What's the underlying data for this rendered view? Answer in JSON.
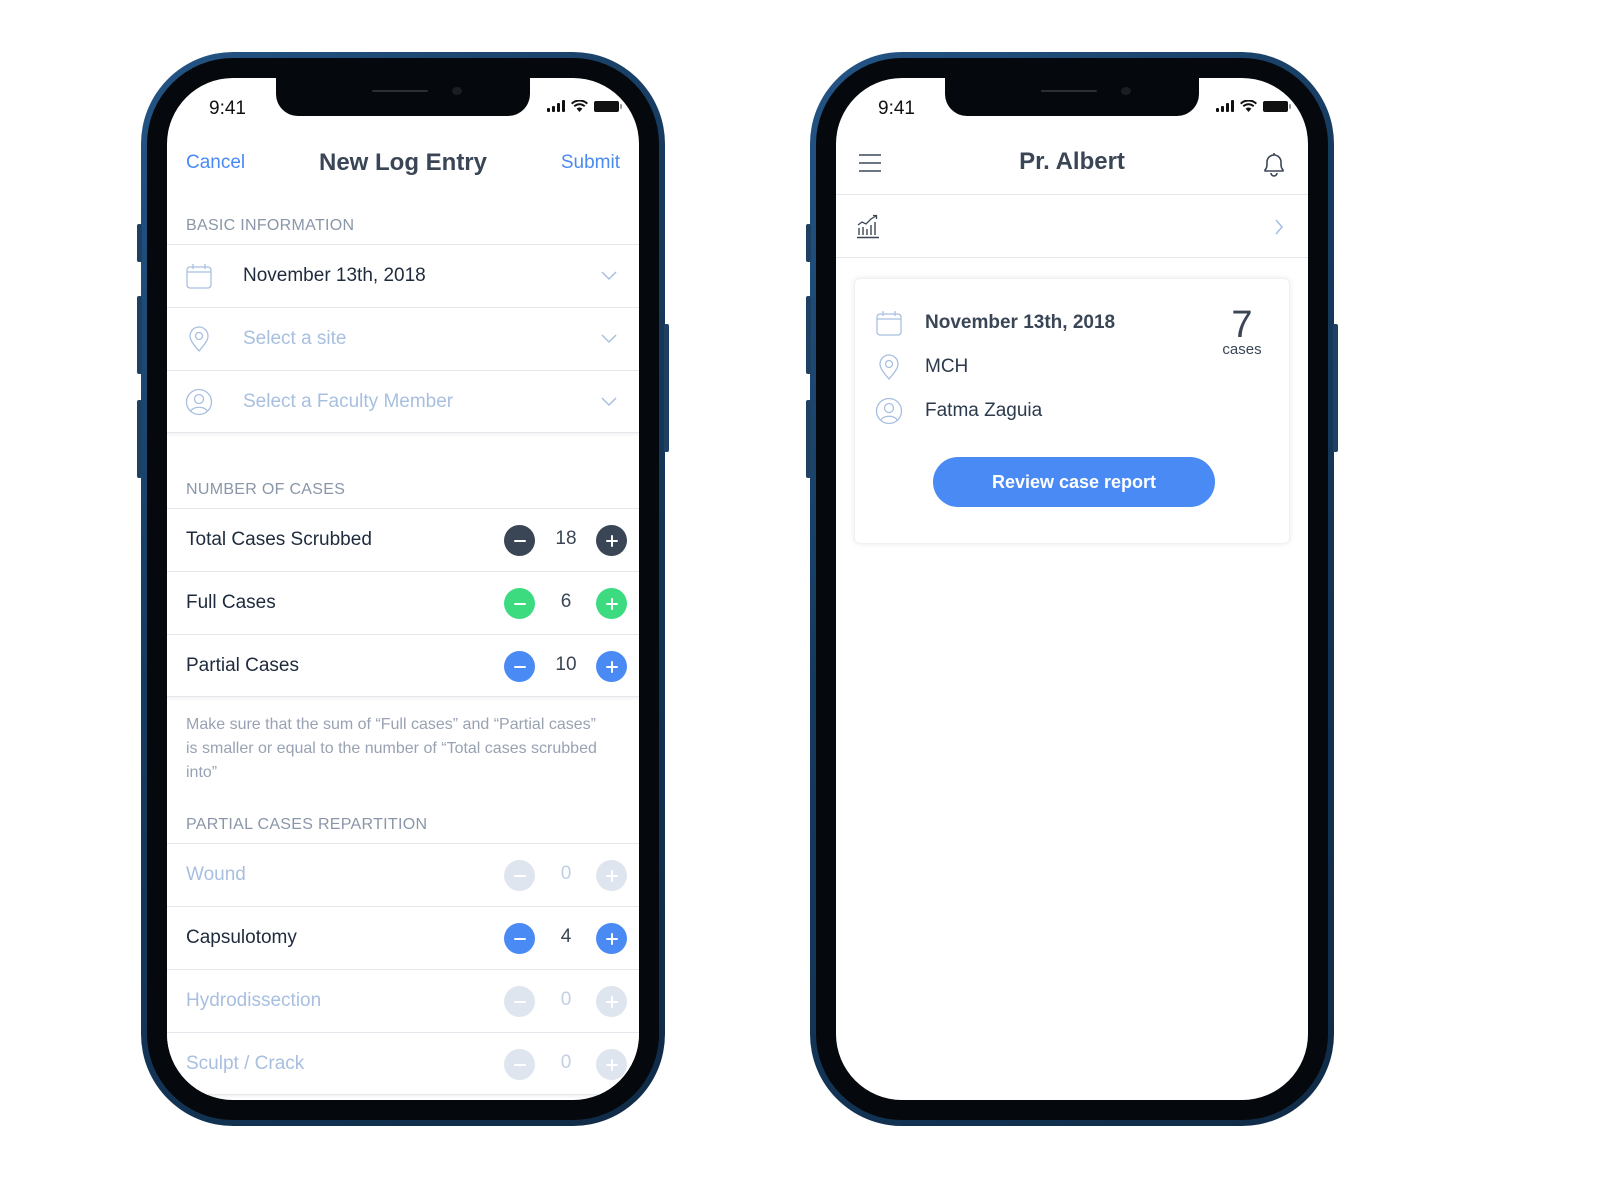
{
  "colors": {
    "accent_blue": "#4a8af4",
    "dark_stepper": "#3a4656",
    "green_stepper": "#3ddb80",
    "disabled_stepper": "#dfe5ee",
    "placeholder_text": "#a8bfe0",
    "section_header": "#8a96a8"
  },
  "left_phone": {
    "status_bar": {
      "time": "9:41"
    },
    "nav": {
      "cancel_label": "Cancel",
      "title": "New Log Entry",
      "submit_label": "Submit"
    },
    "basic_information": {
      "header": "BASIC INFORMATION",
      "fields": [
        {
          "icon": "calendar-icon",
          "value": "November 13th, 2018",
          "is_placeholder": false
        },
        {
          "icon": "location-pin-icon",
          "placeholder": "Select a site",
          "is_placeholder": true
        },
        {
          "icon": "user-circle-icon",
          "placeholder": "Select a Faculty Member",
          "is_placeholder": true
        }
      ]
    },
    "number_of_cases": {
      "header": "NUMBER OF CASES",
      "counters": [
        {
          "label": "Total Cases Scrubbed",
          "value": "18",
          "style": "dark"
        },
        {
          "label": "Full Cases",
          "value": "6",
          "style": "green"
        },
        {
          "label": "Partial Cases",
          "value": "10",
          "style": "blue"
        }
      ],
      "helper_text": "Make sure that the sum of “Full cases” and “Partial cases” is smaller or equal to the number of “Total cases scrubbed into”"
    },
    "partial_cases_repartition": {
      "header": "PARTIAL CASES REPARTITION",
      "counters": [
        {
          "label": "Wound",
          "value": "0",
          "style": "disabled"
        },
        {
          "label": "Capsulotomy",
          "value": "4",
          "style": "blue"
        },
        {
          "label": "Hydrodissection",
          "value": "0",
          "style": "disabled"
        },
        {
          "label": "Sculpt / Crack",
          "value": "0",
          "style": "disabled"
        }
      ]
    }
  },
  "right_phone": {
    "status_bar": {
      "time": "9:41"
    },
    "nav": {
      "title": "Pr. Albert",
      "menu_icon": "hamburger-menu-icon",
      "notification_icon": "bell-icon"
    },
    "stats_row": {
      "icon": "chart-growth-icon"
    },
    "case_card": {
      "date": "November 13th, 2018",
      "site": "MCH",
      "faculty": "Fatma Zaguia",
      "case_count": "7",
      "case_count_label": "cases",
      "button_label": "Review case report"
    }
  }
}
